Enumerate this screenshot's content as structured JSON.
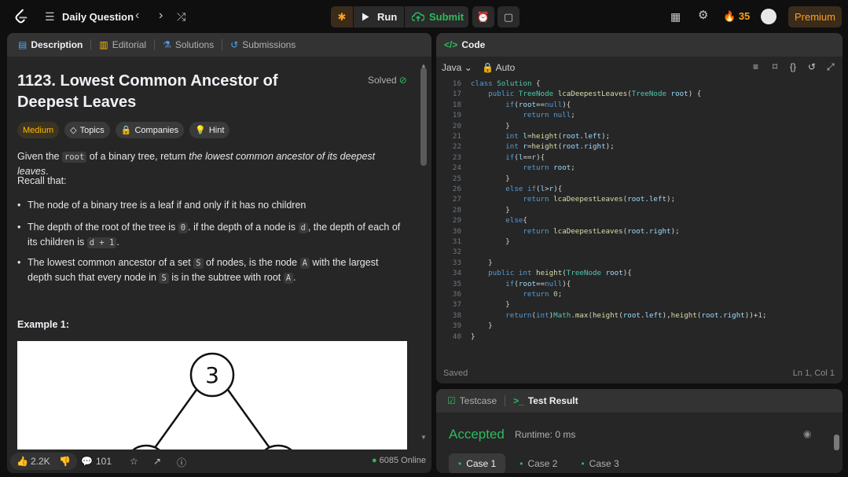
{
  "topbar": {
    "title": "Daily Question",
    "run_label": "Run",
    "submit_label": "Submit",
    "streak_count": "35",
    "premium_label": "Premium"
  },
  "left_tabs": [
    {
      "label": "Description",
      "icon": "description-icon"
    },
    {
      "label": "Editorial",
      "icon": "book-icon"
    },
    {
      "label": "Solutions",
      "icon": "flask-icon"
    },
    {
      "label": "Submissions",
      "icon": "history-icon"
    }
  ],
  "problem": {
    "title": "1123. Lowest Common Ancestor of Deepest Leaves",
    "solved_label": "Solved",
    "difficulty": "Medium",
    "chips": [
      "Topics",
      "Companies",
      "Hint"
    ],
    "desc_pre": "Given the ",
    "desc_code": "root",
    "desc_mid": " of a binary tree, return ",
    "desc_em": "the lowest common ancestor of its deepest leaves",
    "desc_post": ".",
    "recall": "Recall that:",
    "b1": "The node of a binary tree is a leaf if and only if it has no children",
    "b2_a": "The depth of the root of the tree is ",
    "b2_c1": "0",
    "b2_b": ". if the depth of a node is ",
    "b2_c2": "d",
    "b2_c": ", the depth of each of its children is ",
    "b2_c3": "d + 1",
    "b2_d": ".",
    "b3_a": "The lowest common ancestor of a set ",
    "b3_c1": "S",
    "b3_b": " of nodes, is the node ",
    "b3_c2": "A",
    "b3_c": " with the largest depth such that every node in ",
    "b3_c3": "S",
    "b3_d": " is in the subtree with root ",
    "b3_c4": "A",
    "b3_e": ".",
    "example_title": "Example 1:",
    "tree_root_value": "3"
  },
  "bottom_bar": {
    "likes": "2.2K",
    "comments": "101",
    "online": "6085 Online"
  },
  "code_panel": {
    "tab_label": "Code",
    "language": "Java",
    "mode": "Auto",
    "status_left": "Saved",
    "status_right": "Ln 1, Col 1"
  },
  "result_panel": {
    "tab_testcase": "Testcase",
    "tab_result": "Test Result",
    "verdict": "Accepted",
    "runtime": "Runtime: 0 ms",
    "cases": [
      "Case 1",
      "Case 2",
      "Case 3"
    ]
  },
  "colors": {
    "accent": "#ffa116",
    "success": "#2cbb5d",
    "medium": "#ffb800",
    "panel": "#262626",
    "background": "#0f0f0f"
  }
}
